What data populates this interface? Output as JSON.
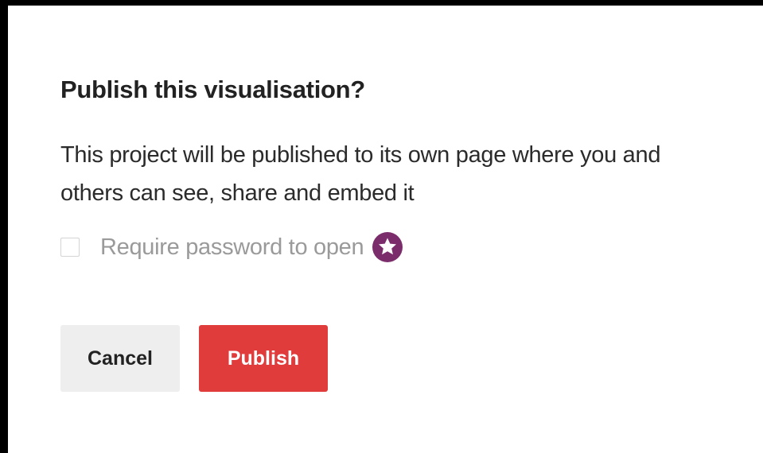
{
  "dialog": {
    "title": "Publish this visualisation?",
    "description": "This project will be published to its own page where you and others can see, share and embed it",
    "password_option": {
      "label": "Require password to open",
      "checked": false,
      "badge_icon": "star-icon",
      "badge_color": "#7b2d6b"
    },
    "buttons": {
      "cancel_label": "Cancel",
      "publish_label": "Publish",
      "publish_color": "#e03c3c"
    }
  }
}
